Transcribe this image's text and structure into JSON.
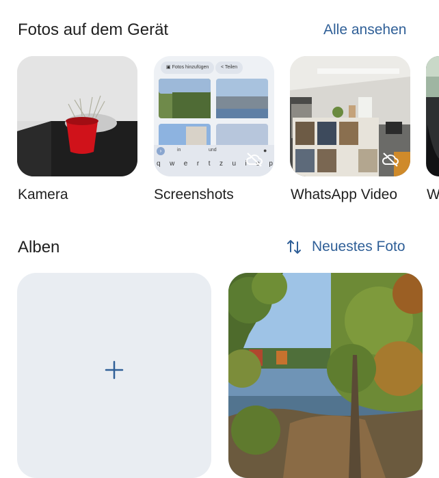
{
  "device_section": {
    "title": "Fotos auf dem Gerät",
    "see_all": "Alle ansehen",
    "folders": [
      {
        "label": "Kamera",
        "icon": "camera-folder-thumbnail"
      },
      {
        "label": "Screenshots",
        "icon": "screenshots-folder-thumbnail"
      },
      {
        "label": "WhatsApp Video",
        "icon": "whatsapp-video-folder-thumbnail"
      },
      {
        "label": "W",
        "icon": "partial-folder-thumbnail"
      }
    ],
    "screenshot_thumb": {
      "chip_add": "Fotos hinzufügen",
      "chip_share": "Teilen",
      "suggestions": [
        "in",
        "und"
      ],
      "keys": [
        "q",
        "w",
        "e",
        "r",
        "t",
        "z",
        "u",
        "i",
        "o",
        "p"
      ]
    }
  },
  "albums_section": {
    "title": "Alben",
    "sort_label": "Neuestes Foto",
    "sort_icon": "swap-vert-icon",
    "new_album_icon": "plus-icon"
  },
  "colors": {
    "accent": "#2f5f97",
    "new_album_bg": "#e9edf2"
  }
}
